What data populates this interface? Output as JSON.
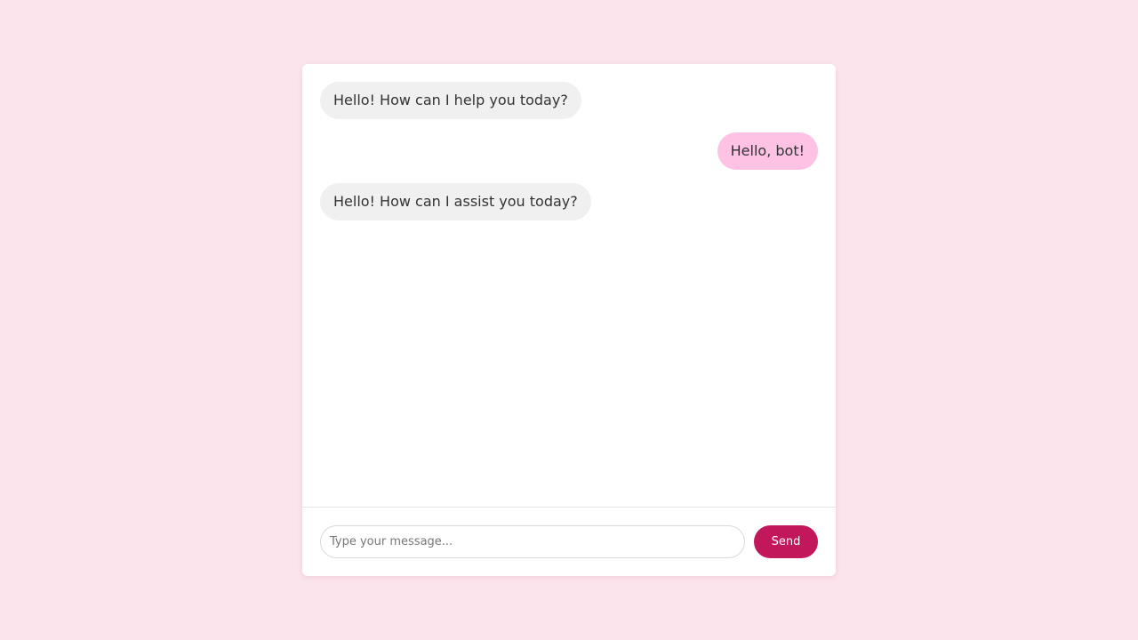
{
  "chat": {
    "messages": [
      {
        "sender": "bot",
        "text": "Hello! How can I help you today?"
      },
      {
        "sender": "user",
        "text": "Hello, bot!"
      },
      {
        "sender": "bot",
        "text": "Hello! How can I assist you today?"
      }
    ]
  },
  "composer": {
    "placeholder": "Type your message...",
    "value": "",
    "send_label": "Send"
  },
  "colors": {
    "page_background": "#fbe4eb",
    "bot_bubble": "#f0f0f0",
    "user_bubble": "#fec2e4",
    "send_button": "#c2185b"
  }
}
